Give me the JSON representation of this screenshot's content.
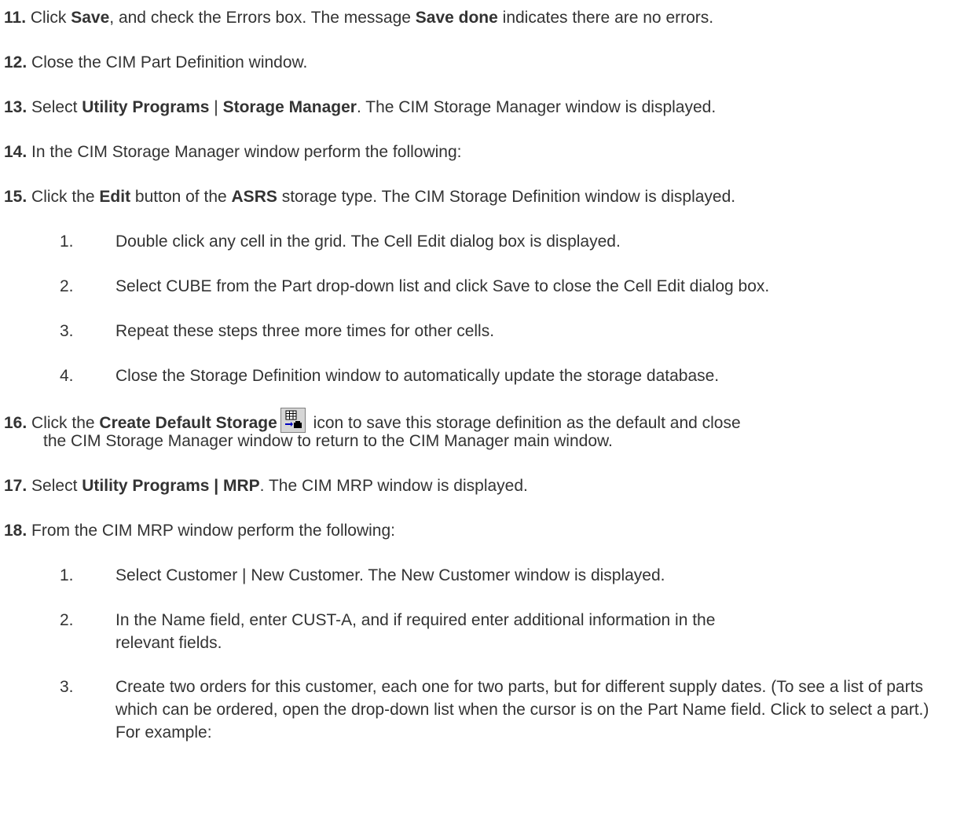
{
  "steps": {
    "s11": {
      "num": "11.",
      "a": "Click ",
      "b1": "Save",
      "c": ", and check the Errors box. The message ",
      "b2": "Save done",
      "d": " indicates there are no errors."
    },
    "s12": {
      "num": "12.",
      "a": "Close the CIM Part Definition window."
    },
    "s13": {
      "num": "13.",
      "a": "Select ",
      "b1": "Utility Programs",
      "c": " | ",
      "b2": "Storage Manager",
      "d": ". The CIM Storage Manager window is displayed."
    },
    "s14": {
      "num": "14.",
      "a": "In the CIM Storage Manager window perform the following:"
    },
    "s15": {
      "num": "15.",
      "a": "Click the ",
      "b1": "Edit",
      "c": " button of the ",
      "b2": "ASRS",
      "d": " storage type. The CIM Storage Definition window is displayed."
    },
    "s15_sub": [
      {
        "num": "1.",
        "text": "Double click any cell in the grid. The Cell Edit dialog box is displayed."
      },
      {
        "num": "2.",
        "text": "Select CUBE from the Part drop-down list and click Save to close the Cell Edit dialog box."
      },
      {
        "num": "3.",
        "text": "Repeat these steps three more times for other cells."
      },
      {
        "num": "4.",
        "text": "Close the Storage Definition window to automatically update the storage database."
      }
    ],
    "s16": {
      "num": "16.",
      "a": "Click the ",
      "b1": "Create Default Storage",
      "icon": "create-default-storage-icon",
      "c": " icon to save this storage definition as the default and close",
      "line2": "the CIM Storage Manager window to return to the CIM Manager main window."
    },
    "s17": {
      "num": "17.",
      "a": "Select ",
      "b1": "Utility Programs | MRP",
      "c": ". The CIM MRP window is displayed."
    },
    "s18": {
      "num": "18.",
      "a": "From the CIM MRP window perform the following:"
    },
    "s18_sub": [
      {
        "num": "1.",
        "text": "Select Customer | New Customer. The New Customer window is displayed."
      },
      {
        "num": "2.",
        "text": "In the Name field, enter CUST-A, and if required enter additional information in the relevant fields."
      },
      {
        "num": "3.",
        "text": "Create two orders for this customer, each one for two parts, but for different supply dates. (To see a list of parts which can be ordered, open the drop-down list when the cursor is on the Part Name field. Click to select a part.) For example:"
      }
    ]
  }
}
